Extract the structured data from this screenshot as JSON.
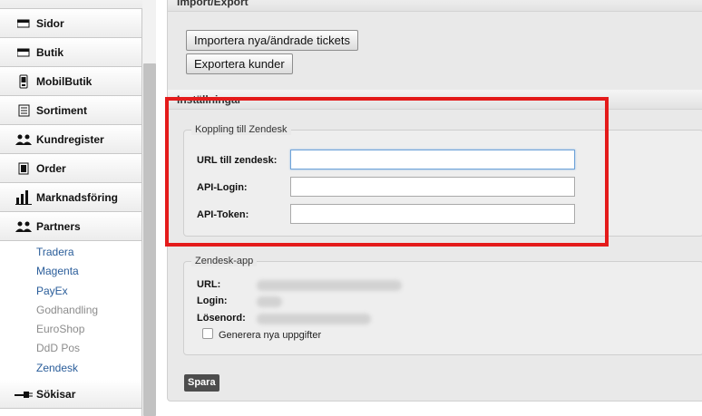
{
  "sidebar": {
    "items": [
      {
        "label": "Sidor",
        "icon": "page-icon"
      },
      {
        "label": "Butik",
        "icon": "store-icon"
      },
      {
        "label": "MobilButik",
        "icon": "mobile-icon"
      },
      {
        "label": "Sortiment",
        "icon": "list-icon"
      },
      {
        "label": "Kundregister",
        "icon": "users-icon"
      },
      {
        "label": "Order",
        "icon": "order-icon"
      },
      {
        "label": "Marknadsföring",
        "icon": "bar-chart-icon"
      },
      {
        "label": "Partners",
        "icon": "users-icon"
      }
    ],
    "sub_items": [
      {
        "label": "Tradera",
        "state": "active"
      },
      {
        "label": "Magenta",
        "state": "active"
      },
      {
        "label": "PayEx",
        "state": "active"
      },
      {
        "label": "Godhandling",
        "state": "inactive"
      },
      {
        "label": "EuroShop",
        "state": "inactive"
      },
      {
        "label": "DdD Pos",
        "state": "inactive"
      },
      {
        "label": "Zendesk",
        "state": "active"
      }
    ],
    "bottom_item": {
      "label": "Sökisar",
      "icon": "plug-icon"
    }
  },
  "import_export": {
    "title": "Import/Export",
    "import_button": "Importera nya/ändrade tickets",
    "export_button": "Exportera kunder"
  },
  "settings": {
    "title": "Inställningar",
    "zendesk_fieldset": {
      "legend": "Koppling till Zendesk",
      "url_label": "URL till zendesk:",
      "url_value": "",
      "api_login_label": "API-Login:",
      "api_login_value": "",
      "api_token_label": "API-Token:",
      "api_token_value": ""
    },
    "app_fieldset": {
      "legend": "Zendesk-app",
      "url_label": "URL:",
      "login_label": "Login:",
      "password_label": "Lösenord:",
      "checkbox_label": "Generera nya uppgifter"
    },
    "save_button": "Spara"
  },
  "colors": {
    "highlight": "#e41b1b",
    "link": "#2a5d9a",
    "disabled": "#8c8c8c",
    "save_button_bg": "#4d4d4d"
  }
}
